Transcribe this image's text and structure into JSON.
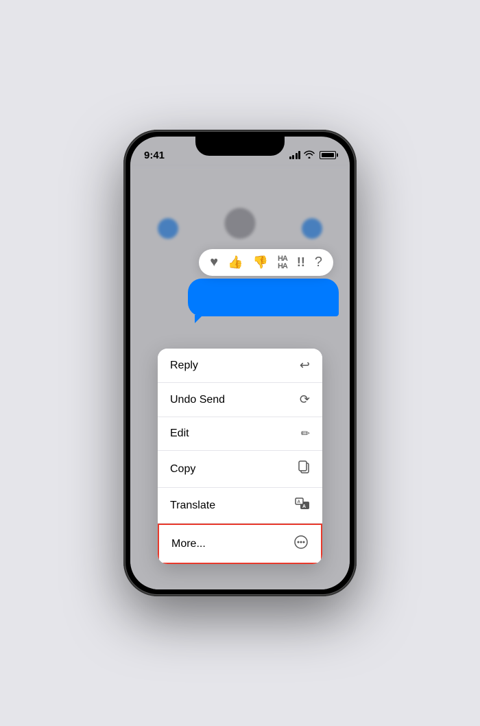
{
  "status_bar": {
    "time": "9:41",
    "signal_label": "signal",
    "wifi_label": "wifi",
    "battery_label": "battery"
  },
  "reaction_bar": {
    "items": [
      {
        "id": "heart",
        "symbol": "♥",
        "label": "Love"
      },
      {
        "id": "thumbsup",
        "symbol": "👍",
        "label": "Like"
      },
      {
        "id": "thumbsdown",
        "symbol": "👎",
        "label": "Dislike"
      },
      {
        "id": "haha",
        "symbol": "HAHA",
        "label": "Haha"
      },
      {
        "id": "exclamation",
        "symbol": "‼",
        "label": "Emphasize"
      },
      {
        "id": "question",
        "symbol": "?",
        "label": "Question"
      }
    ]
  },
  "context_menu": {
    "items": [
      {
        "id": "reply",
        "label": "Reply",
        "icon": "↩"
      },
      {
        "id": "undo-send",
        "label": "Undo Send",
        "icon": "↺"
      },
      {
        "id": "edit",
        "label": "Edit",
        "icon": "✏"
      },
      {
        "id": "copy",
        "label": "Copy",
        "icon": "⧉"
      },
      {
        "id": "translate",
        "label": "Translate",
        "icon": "🔤"
      },
      {
        "id": "more",
        "label": "More...",
        "icon": "⊙",
        "highlighted": true
      }
    ]
  }
}
